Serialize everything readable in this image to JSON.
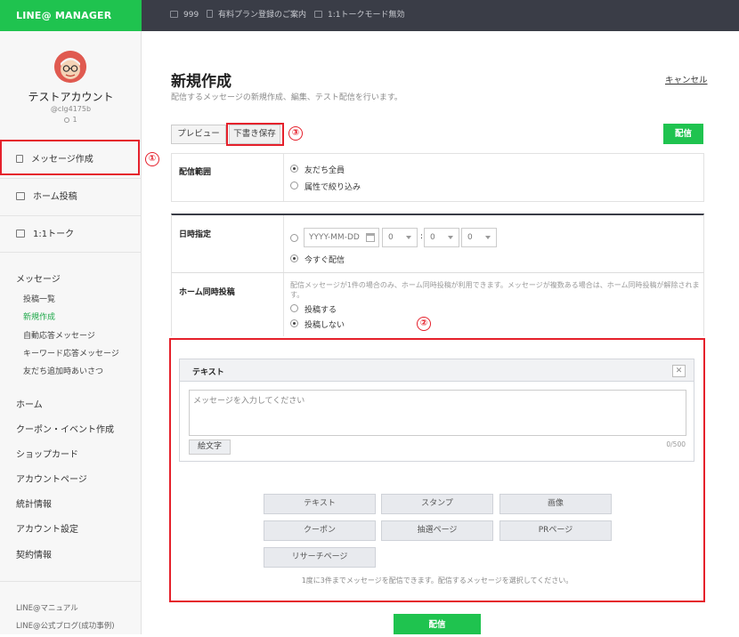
{
  "topbar": {
    "logo": "LINE@ MANAGER",
    "count": "999",
    "plan_text": "有料プラン登録のご案内",
    "talk_mode": "1:1トークモード無効"
  },
  "account": {
    "name": "テストアカウント",
    "id": "@clg4175b",
    "followers": "1"
  },
  "sidebar": {
    "message_create": "メッセージ作成",
    "home_post": "ホーム投稿",
    "talk": "1:1トーク",
    "message_section": "メッセージ",
    "sub_items": [
      "投稿一覧",
      "新規作成",
      "自動応答メッセージ",
      "キーワード応答メッセージ",
      "友だち追加時あいさつ"
    ],
    "main_items": [
      "ホーム",
      "クーポン・イベント作成",
      "ショップカード",
      "アカウントページ",
      "統計情報",
      "アカウント設定",
      "契約情報"
    ],
    "footer": [
      "LINE@マニュアル",
      "LINE@公式ブログ(成功事例)"
    ]
  },
  "page": {
    "title": "新規作成",
    "subtitle": "配信するメッセージの新規作成、編集、テスト配信を行います。",
    "cancel": "キャンセル"
  },
  "toolbar": {
    "preview": "プレビュー",
    "draft_save": "下書き保存",
    "send": "配信"
  },
  "form": {
    "range_label": "配信範囲",
    "range_options": [
      "友だち全員",
      "属性で絞り込み"
    ],
    "date_label": "日時指定",
    "date_placeholder": "YYYY-MM-DD",
    "hour": "0",
    "minute": "0",
    "second": "0",
    "now_label": "今すぐ配信",
    "home_label": "ホーム同時投稿",
    "home_note": "配信メッセージが1件の場合のみ、ホーム同時投稿が利用できます。メッセージが複数ある場合は、ホーム同時投稿が解除されます。",
    "home_options": [
      "投稿する",
      "投稿しない"
    ]
  },
  "editor": {
    "title": "テキスト",
    "placeholder": "メッセージを入力してください",
    "emoji_button": "絵文字",
    "counter": "0/500"
  },
  "types": [
    "テキスト",
    "スタンプ",
    "画像",
    "クーポン",
    "抽選ページ",
    "PRページ",
    "リサーチページ"
  ],
  "types_note": "1度に3件までメッセージを配信できます。配信するメッセージを選択してください。",
  "bottom_send": "配信",
  "annotations": [
    "①",
    "②",
    "③"
  ],
  "colors": {
    "brand_green": "#1fc34f",
    "topbar": "#3a3d47",
    "highlight_red": "#e5202b"
  }
}
